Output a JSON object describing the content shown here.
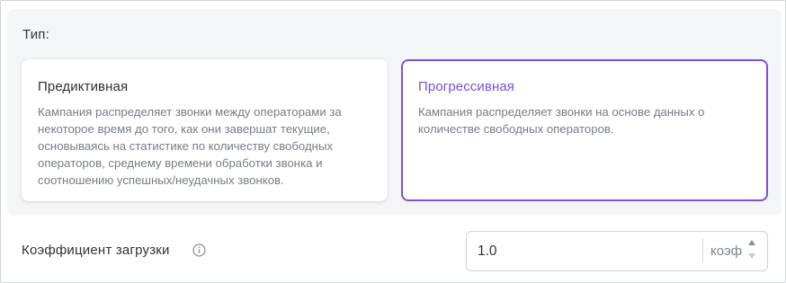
{
  "type_section": {
    "label": "Тип:",
    "options": [
      {
        "title": "Предиктивная",
        "description": "Кампания распределяет звонки между операторами за некоторое время до того, как они завершат текущие, основываясь на статистике по количеству свободных операторов, среднему времени обработки звонка и соотношению успешных/неудачных звонков.",
        "selected": false
      },
      {
        "title": "Прогрессивная",
        "description": "Кампания распределяет звонки на основе данных о количестве свободных операторов.",
        "selected": true
      }
    ]
  },
  "load_factor": {
    "label": "Коэффициент загрузки",
    "info_icon": "info-circle-icon",
    "value": "1.0",
    "unit": "коэф"
  },
  "colors": {
    "accent": "#7b4fe0",
    "panel_bg": "#f4f5f7",
    "description_text": "#767d86"
  }
}
